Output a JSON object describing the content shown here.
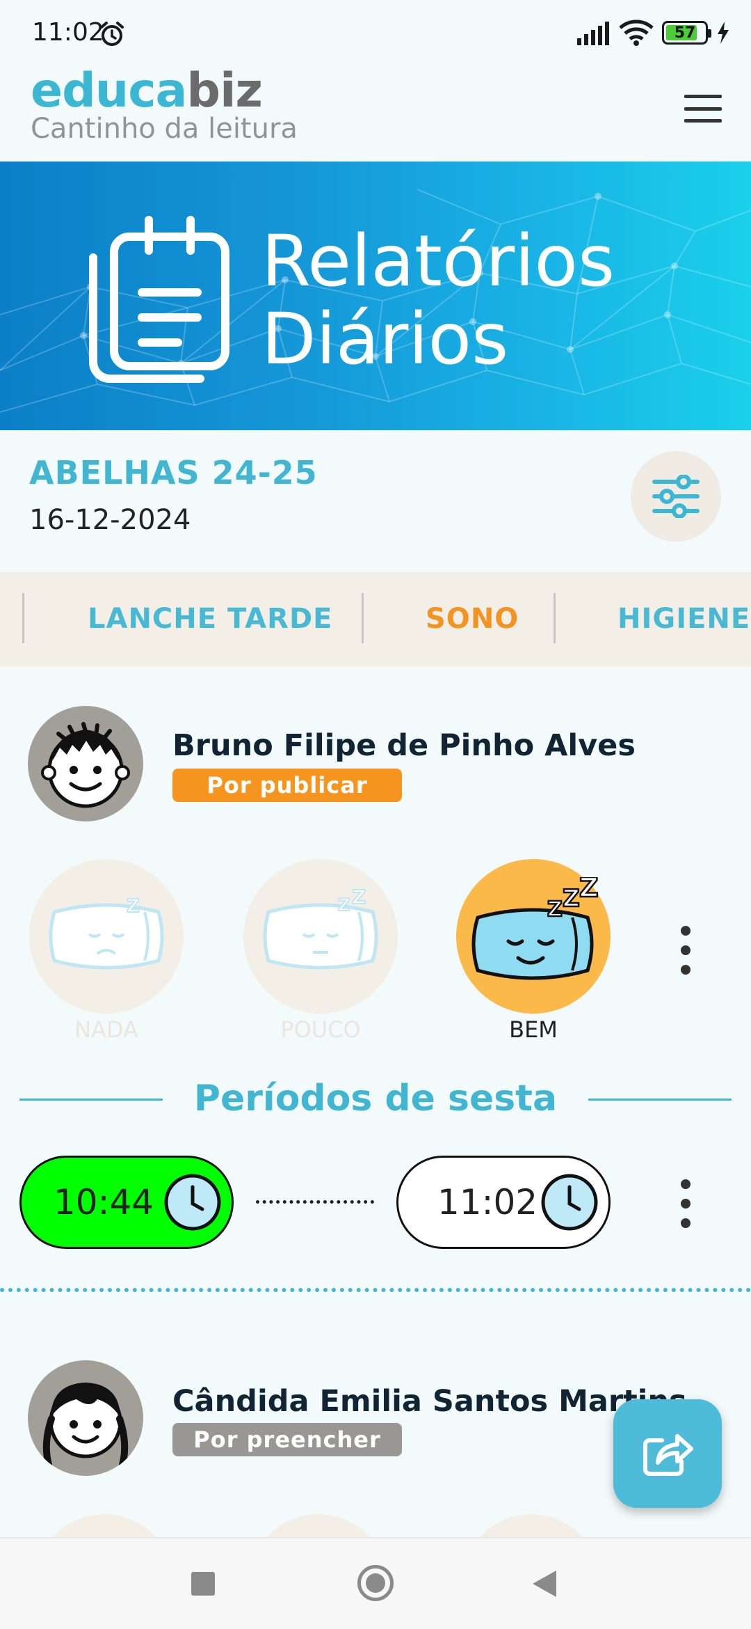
{
  "status_bar": {
    "time": "11:02",
    "battery": "57"
  },
  "brand": {
    "logo_part1": "educa",
    "logo_part2": "biz",
    "school": "Cantinho da leitura"
  },
  "banner": {
    "title_line1": "Relatórios",
    "title_line2": "Diários"
  },
  "class_info": {
    "name": "ABELHAS 24-25",
    "date": "16-12-2024"
  },
  "tabs": [
    {
      "label": "LANCHE TARDE",
      "active": false
    },
    {
      "label": "SONO",
      "active": true
    },
    {
      "label": "HIGIENE",
      "active": false
    }
  ],
  "students": [
    {
      "name": "Bruno Filipe de Pinho Alves",
      "status": "Por publicar",
      "sleep_options": [
        {
          "label": "NADA",
          "selected": false
        },
        {
          "label": "POUCO",
          "selected": false
        },
        {
          "label": "BEM",
          "selected": true
        }
      ],
      "nap_section_title": "Períodos de sesta",
      "nap": {
        "start": "10:44",
        "end": "11:02"
      }
    },
    {
      "name": "Cândida Emilia Santos Martins",
      "status": "Por preencher"
    }
  ],
  "colors": {
    "accent": "#42b6d1",
    "active_tab": "#f39322",
    "start_time_bg": "#00ff00",
    "selected_option": "#fbb94a"
  },
  "icons": {
    "menu": "hamburger-icon",
    "filter": "sliders-icon",
    "share": "share-icon",
    "clock": "clock-icon",
    "more": "more-vertical-icon"
  }
}
